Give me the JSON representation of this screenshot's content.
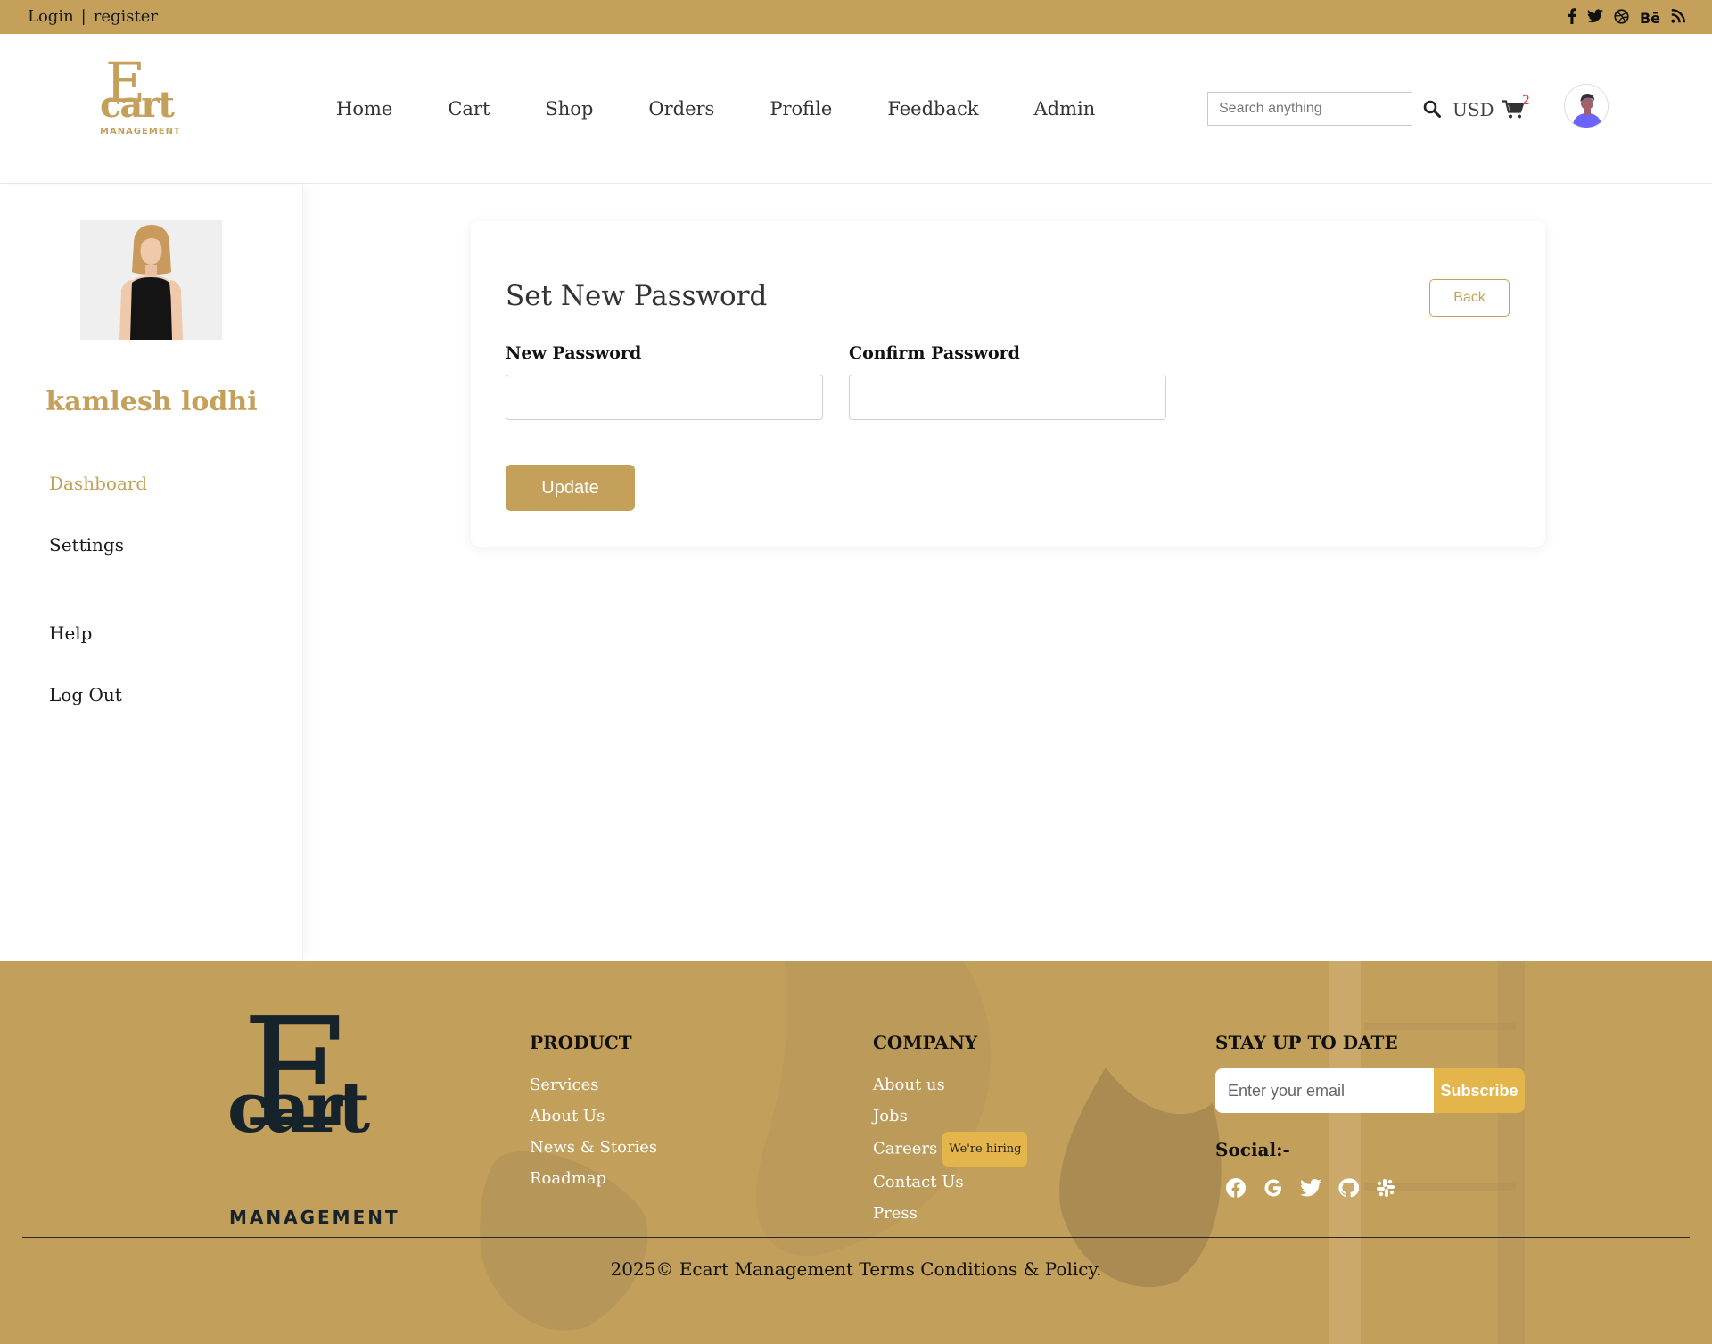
{
  "topbar": {
    "login": "Login",
    "separator": "|",
    "register": "register",
    "social_icons": [
      "facebook-icon",
      "twitter-icon",
      "dribbble-icon",
      "behance-icon",
      "rss-icon"
    ],
    "behance_text": "Bē"
  },
  "header": {
    "logo": {
      "letter": "E",
      "word": "cart",
      "sub": "MANAGEMENT"
    },
    "nav": [
      "Home",
      "Cart",
      "Shop",
      "Orders",
      "Profile",
      "Feedback",
      "Admin"
    ],
    "search_placeholder": "Search anything",
    "currency": "USD",
    "cart_count": "2"
  },
  "sidebar": {
    "username": "kamlesh lodhi",
    "links": [
      {
        "label": "Dashboard",
        "active": true
      },
      {
        "label": "Settings"
      },
      {
        "label": "Help"
      },
      {
        "label": "Log Out"
      }
    ]
  },
  "form": {
    "title": "Set New Password",
    "back": "Back",
    "new_password_label": "New Password",
    "confirm_password_label": "Confirm Password",
    "update": "Update"
  },
  "footer": {
    "logo": {
      "letter": "E",
      "word": "cart",
      "sub": "MANAGEMENT"
    },
    "product": {
      "title": "PRODUCT",
      "links": [
        "Services",
        "About Us",
        "News & Stories",
        "Roadmap"
      ]
    },
    "company": {
      "title": "COMPANY",
      "links": [
        "About us",
        "Jobs",
        "Careers",
        "Contact Us",
        "Press"
      ],
      "careers_badge": "We're hiring"
    },
    "newsletter": {
      "title": "STAY UP TO DATE",
      "placeholder": "Enter your email",
      "button": "Subscribe"
    },
    "social_label": "Social:-",
    "social_icons": [
      "facebook-icon",
      "google-icon",
      "twitter-icon",
      "github-icon",
      "slack-icon"
    ],
    "copyright": "2025© Ecart Management Terms Conditions & Policy."
  },
  "colors": {
    "brand": "#c4a05a",
    "accent": "#e4b54a",
    "cart_badge": "#e53935"
  }
}
